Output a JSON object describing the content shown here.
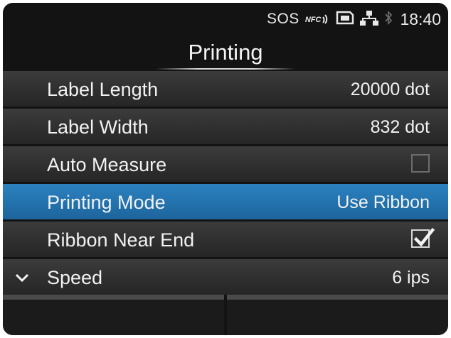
{
  "status": {
    "sos": "SOS",
    "nfc": "NFC",
    "time": "18:40",
    "icons": [
      "nfc-icon",
      "sd-card-icon",
      "network-icon",
      "bluetooth-icon"
    ]
  },
  "screen": {
    "title": "Printing"
  },
  "settings": [
    {
      "label": "Label Length",
      "value": "20000 dot"
    },
    {
      "label": "Label Width",
      "value": "832 dot"
    },
    {
      "label": "Auto Measure",
      "checked": false
    },
    {
      "label": "Printing Mode",
      "value": "Use Ribbon",
      "selected": true
    },
    {
      "label": "Ribbon Near End",
      "checked": true
    },
    {
      "label": "Speed",
      "value": "6 ips"
    }
  ],
  "colors": {
    "selected_row": "#2270ab",
    "background": "#131313",
    "row": "#2f2f2f"
  },
  "softkeys": [
    "",
    ""
  ]
}
